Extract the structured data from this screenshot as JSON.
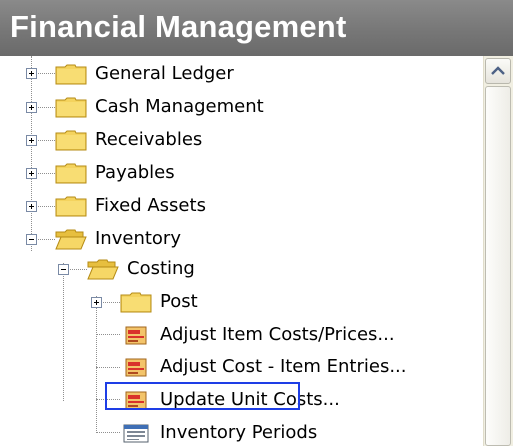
{
  "window": {
    "title": "Financial Management"
  },
  "tree": {
    "items": [
      {
        "label": "General Ledger",
        "icon": "folder-closed-icon",
        "expander": "plus"
      },
      {
        "label": "Cash Management",
        "icon": "folder-closed-icon",
        "expander": "plus"
      },
      {
        "label": "Receivables",
        "icon": "folder-closed-icon",
        "expander": "plus"
      },
      {
        "label": "Payables",
        "icon": "folder-closed-icon",
        "expander": "plus"
      },
      {
        "label": "Fixed Assets",
        "icon": "folder-closed-icon",
        "expander": "plus"
      },
      {
        "label": "Inventory",
        "icon": "folder-open-icon",
        "expander": "minus"
      },
      {
        "label": "Costing",
        "icon": "folder-open-icon",
        "expander": "minus"
      },
      {
        "label": "Post",
        "icon": "folder-closed-icon",
        "expander": "plus"
      },
      {
        "label": "Adjust Item Costs/Prices...",
        "icon": "batch-job-icon"
      },
      {
        "label": "Adjust Cost - Item Entries...",
        "icon": "batch-job-icon",
        "highlighted": true
      },
      {
        "label": "Update Unit Costs...",
        "icon": "batch-job-icon"
      },
      {
        "label": "Inventory Periods",
        "icon": "form-list-icon"
      }
    ]
  },
  "scrollbar": {
    "up_arrow_icon": "chevron-up-icon"
  },
  "colors": {
    "header_bg": "#777777",
    "highlight_border": "#1e3ee6",
    "folder_yellow": "#f4d35e",
    "batch_red": "#d9322b"
  }
}
